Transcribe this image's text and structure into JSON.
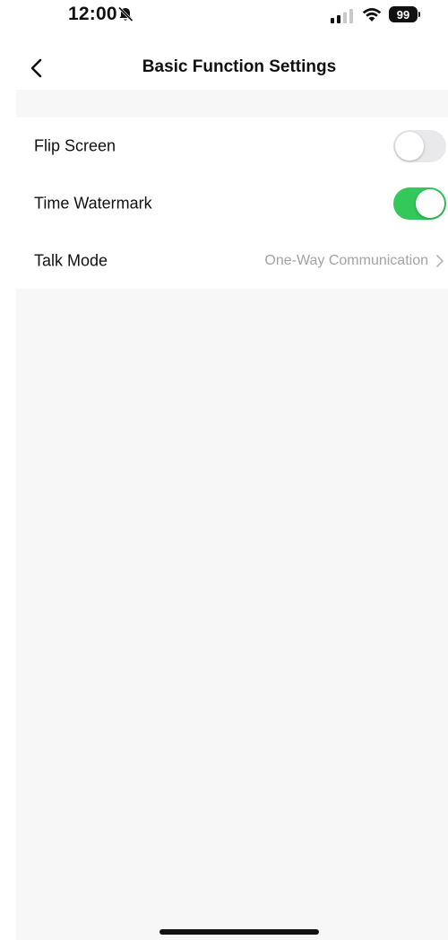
{
  "status_bar": {
    "time": "12:00",
    "battery_level": "99",
    "icons": [
      "bell-slash-icon",
      "signal-icon",
      "wifi-icon",
      "battery-icon"
    ]
  },
  "header": {
    "title": "Basic Function Settings",
    "back_icon": "chevron-left-icon"
  },
  "settings": {
    "flip_screen": {
      "label": "Flip Screen",
      "enabled": false
    },
    "time_watermark": {
      "label": "Time Watermark",
      "enabled": true
    },
    "talk_mode": {
      "label": "Talk Mode",
      "value": "One-Way Communication",
      "icon": "chevron-right-icon"
    }
  },
  "colors": {
    "accent_red": "#c0121c",
    "toggle_on": "#34c759",
    "toggle_off": "#e9e9eb",
    "page_background": "#f7f7f7",
    "secondary_text": "#a3a3a3"
  }
}
